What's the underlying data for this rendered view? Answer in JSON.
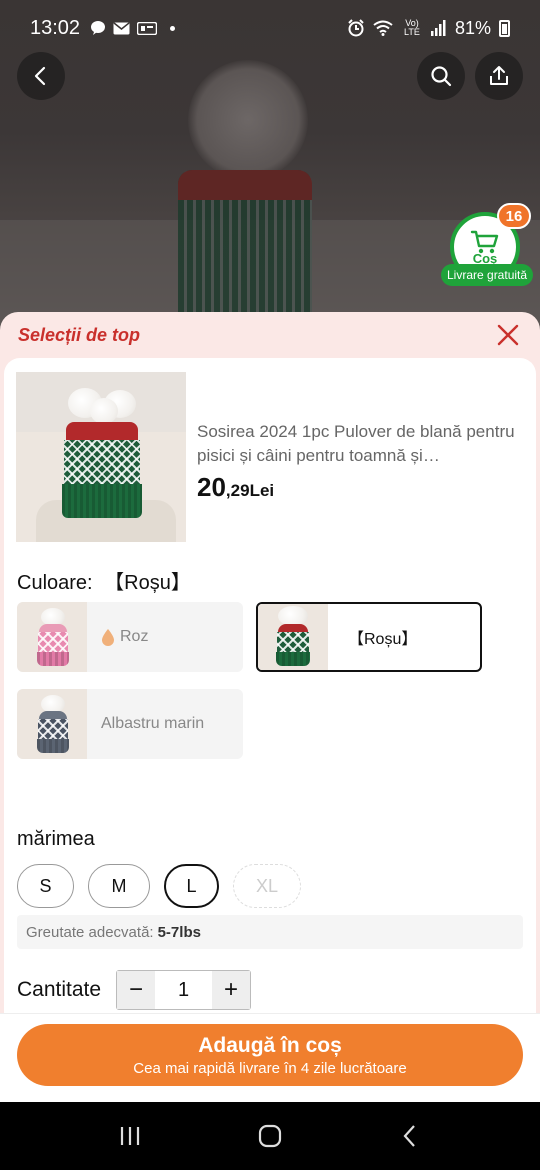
{
  "status_bar": {
    "time": "13:02",
    "battery": "81%",
    "network": "Vo) LTE"
  },
  "cart": {
    "badge_count": "16",
    "label": "Coș",
    "free_shipping": "Livrare gratuită"
  },
  "sheet": {
    "title": "Selecții de top"
  },
  "product": {
    "title": "Sosirea 2024 1pc Pulover de blană pentru pisici și câini pentru toamnă și…",
    "price_int": "20",
    "price_dec": ",29",
    "currency": "Lei"
  },
  "color": {
    "label": "Culoare:",
    "selected": "【Roșu】",
    "options": [
      {
        "label": "Roz",
        "selected": false
      },
      {
        "label": "【Roșu】",
        "selected": true
      },
      {
        "label": "Albastru marin",
        "selected": false
      }
    ]
  },
  "size": {
    "label": "mărimea",
    "options": [
      {
        "label": "S",
        "state": "normal"
      },
      {
        "label": "M",
        "state": "normal"
      },
      {
        "label": "L",
        "state": "selected"
      },
      {
        "label": "XL",
        "state": "disabled"
      }
    ],
    "fit_label": "Greutate adecvată:",
    "fit_value": "5-7lbs"
  },
  "quantity": {
    "label": "Cantitate",
    "value": "1",
    "minus": "−",
    "plus": "+"
  },
  "cta": {
    "primary": "Adaugă în coș",
    "secondary": "Cea mai rapidă livrare în 4 zile lucrătoare"
  },
  "colors": {
    "accent": "#f07f2e",
    "green": "#1fa33a",
    "title_red": "#c9302c"
  },
  "icons": [
    "back-arrow-icon",
    "search-icon",
    "share-icon",
    "cart-icon",
    "close-icon",
    "drop-icon",
    "recents-icon",
    "home-icon",
    "back-nav-icon"
  ]
}
